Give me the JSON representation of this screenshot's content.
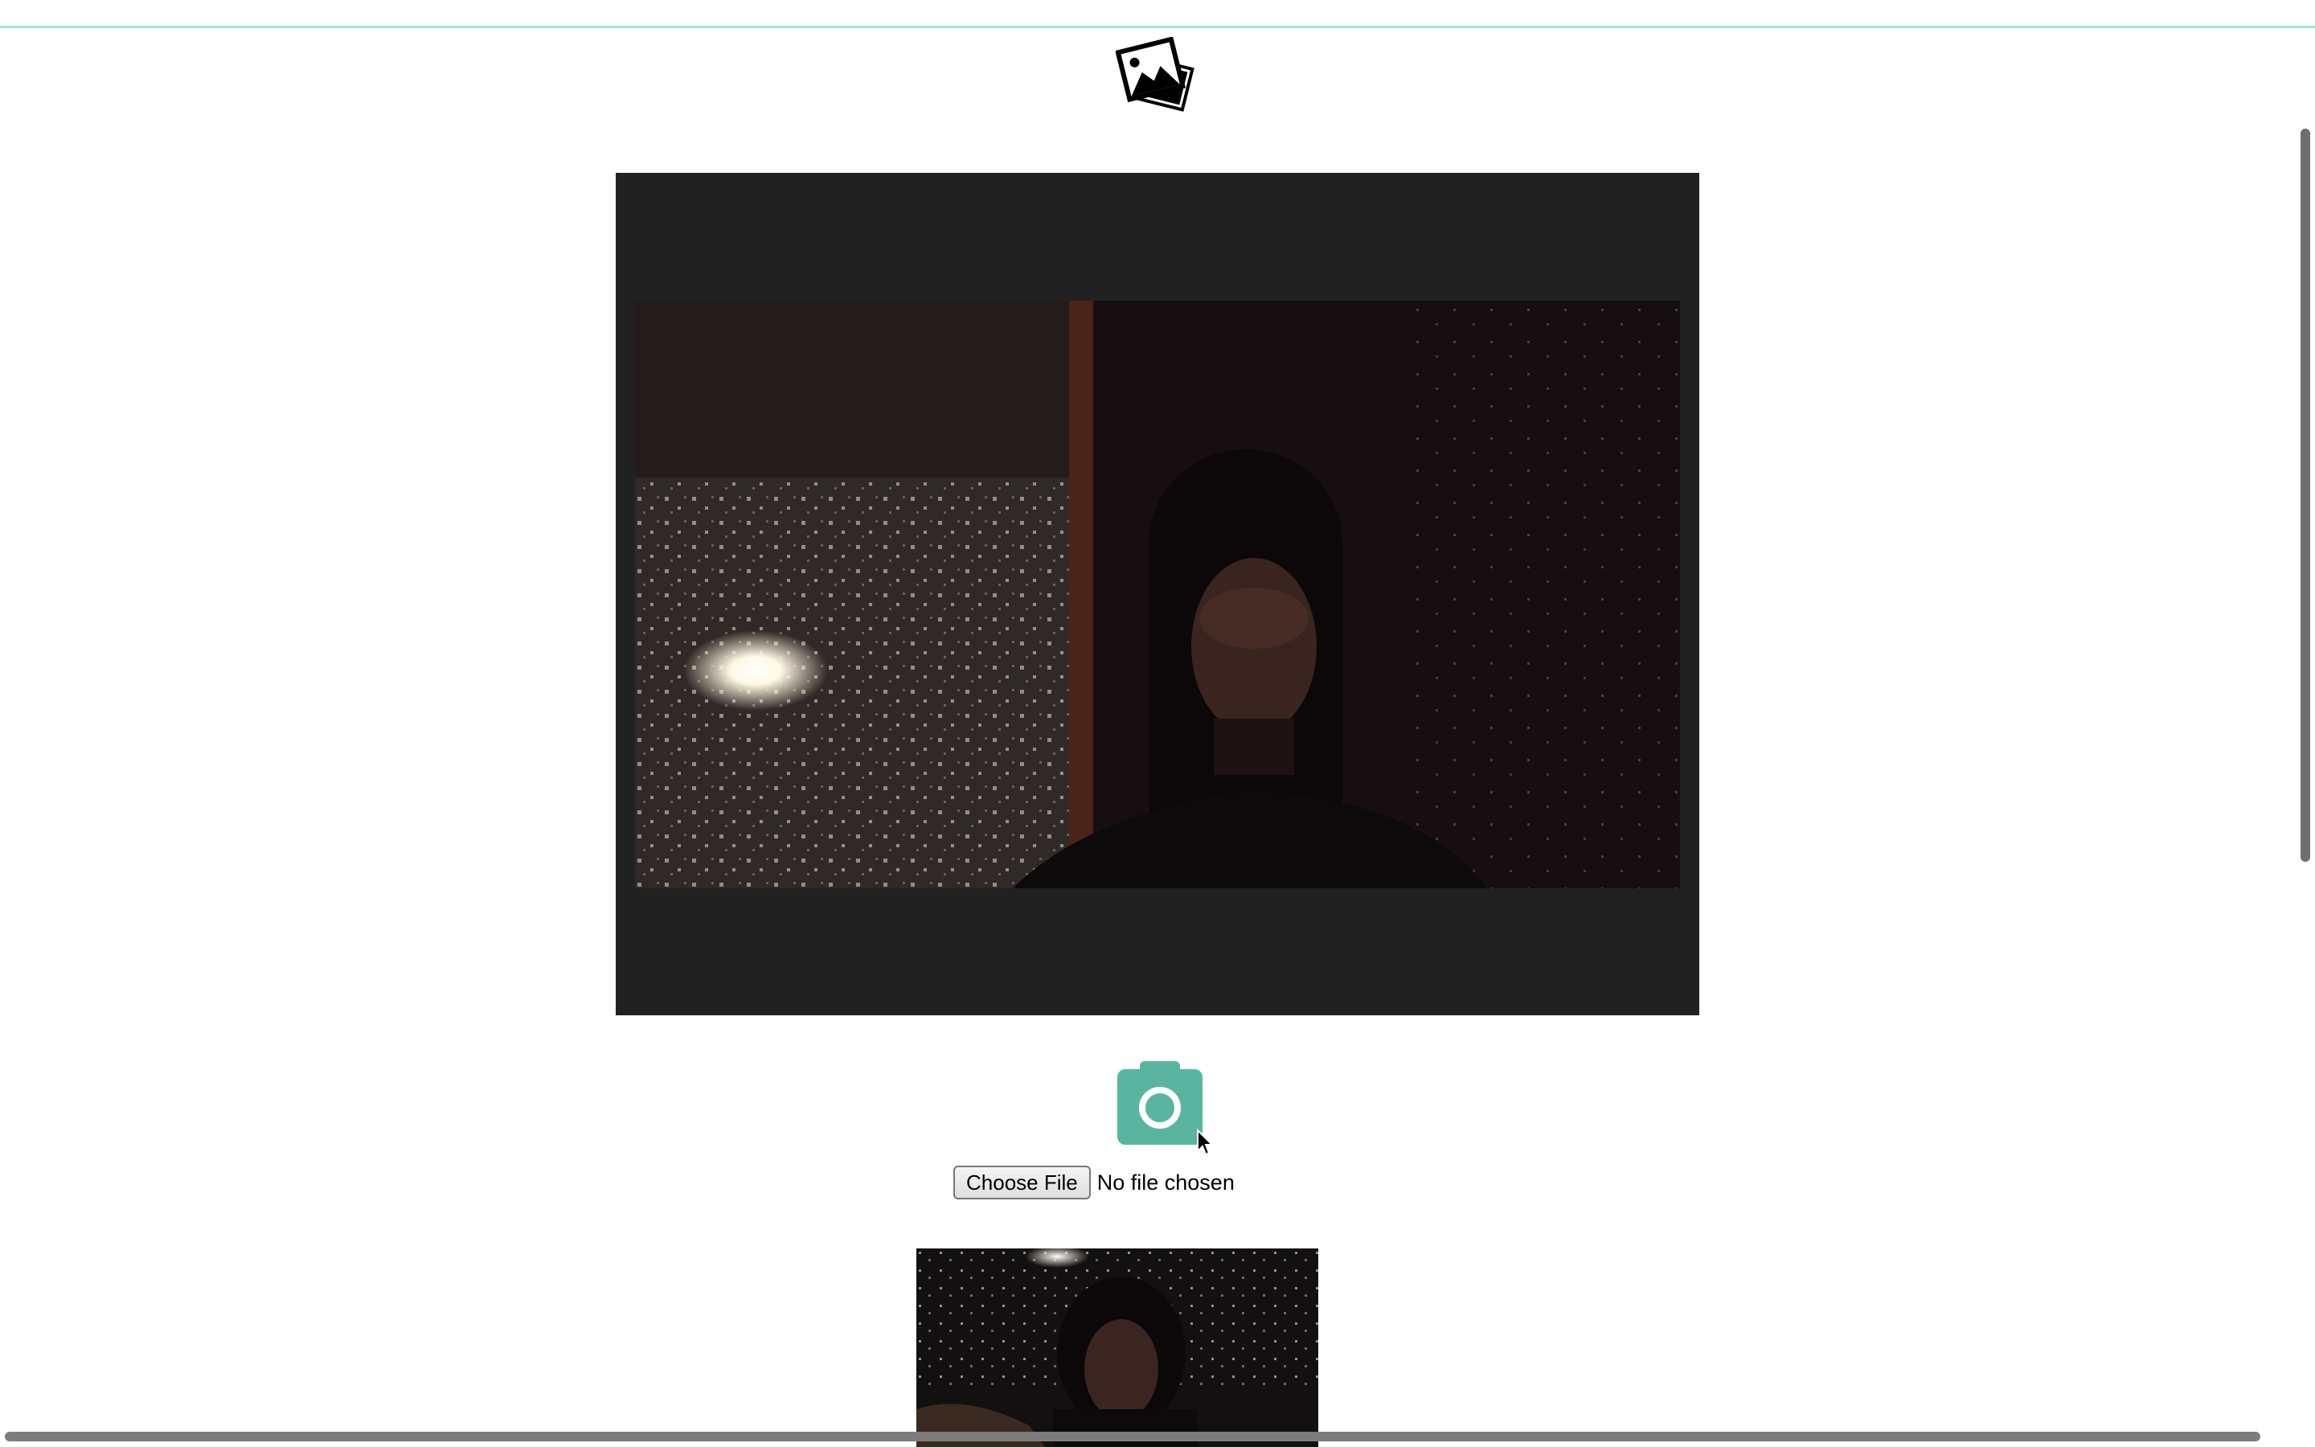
{
  "app": {
    "logo_icon": "photo-stack-icon"
  },
  "camera": {
    "capture_icon": "camera-icon",
    "capture_color": "#5ab5a0"
  },
  "file_input": {
    "button_label": "Choose File",
    "status": "No file chosen"
  },
  "colors": {
    "accent_line": "#9fe3d6",
    "video_frame_bg": "#212121"
  }
}
